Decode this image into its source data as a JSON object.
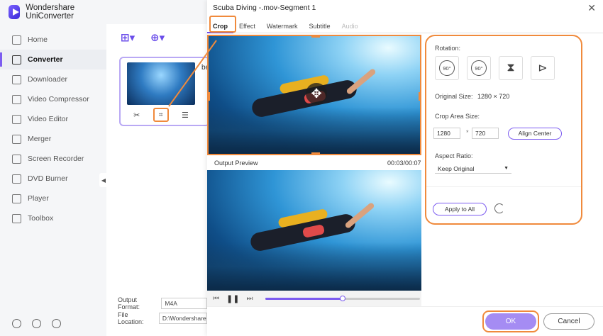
{
  "app": {
    "title": "Wondershare UniConverter"
  },
  "sidebar": {
    "items": [
      {
        "label": "Home"
      },
      {
        "label": "Converter"
      },
      {
        "label": "Downloader"
      },
      {
        "label": "Video Compressor"
      },
      {
        "label": "Video Editor"
      },
      {
        "label": "Merger"
      },
      {
        "label": "Screen Recorder"
      },
      {
        "label": "DVD Burner"
      },
      {
        "label": "Player"
      },
      {
        "label": "Toolbox"
      }
    ],
    "active": "Converter"
  },
  "main": {
    "card_title_fragment": "be",
    "output_format_label": "Output Format:",
    "output_format_value": "M4A",
    "file_location_label": "File Location:",
    "file_location_value": "D:\\Wondershare"
  },
  "dialog": {
    "title": "Scuba Diving -.mov-Segment 1",
    "tabs": [
      {
        "label": "Crop",
        "state": "active"
      },
      {
        "label": "Effect",
        "state": "normal"
      },
      {
        "label": "Watermark",
        "state": "normal"
      },
      {
        "label": "Subtitle",
        "state": "normal"
      },
      {
        "label": "Audio",
        "state": "disabled"
      }
    ],
    "output_preview_label": "Output Preview",
    "time": "00:03/00:07",
    "playback_progress": 0.5,
    "rotation_label": "Rotation:",
    "rotate_left_text": "90°",
    "rotate_right_text": "90°",
    "original_size_label": "Original Size:",
    "original_size_value": "1280 × 720",
    "crop_area_label": "Crop Area Size:",
    "crop_width": "1280",
    "crop_x": "*",
    "crop_height": "720",
    "align_center": "Align Center",
    "aspect_ratio_label": "Aspect Ratio:",
    "aspect_ratio_value": "Keep Original",
    "apply_to_all": "Apply to All",
    "ok": "OK",
    "cancel": "Cancel"
  },
  "colors": {
    "accent": "#7c5cf0",
    "highlight": "#f08a3c",
    "ok_button": "#a58cf3"
  }
}
